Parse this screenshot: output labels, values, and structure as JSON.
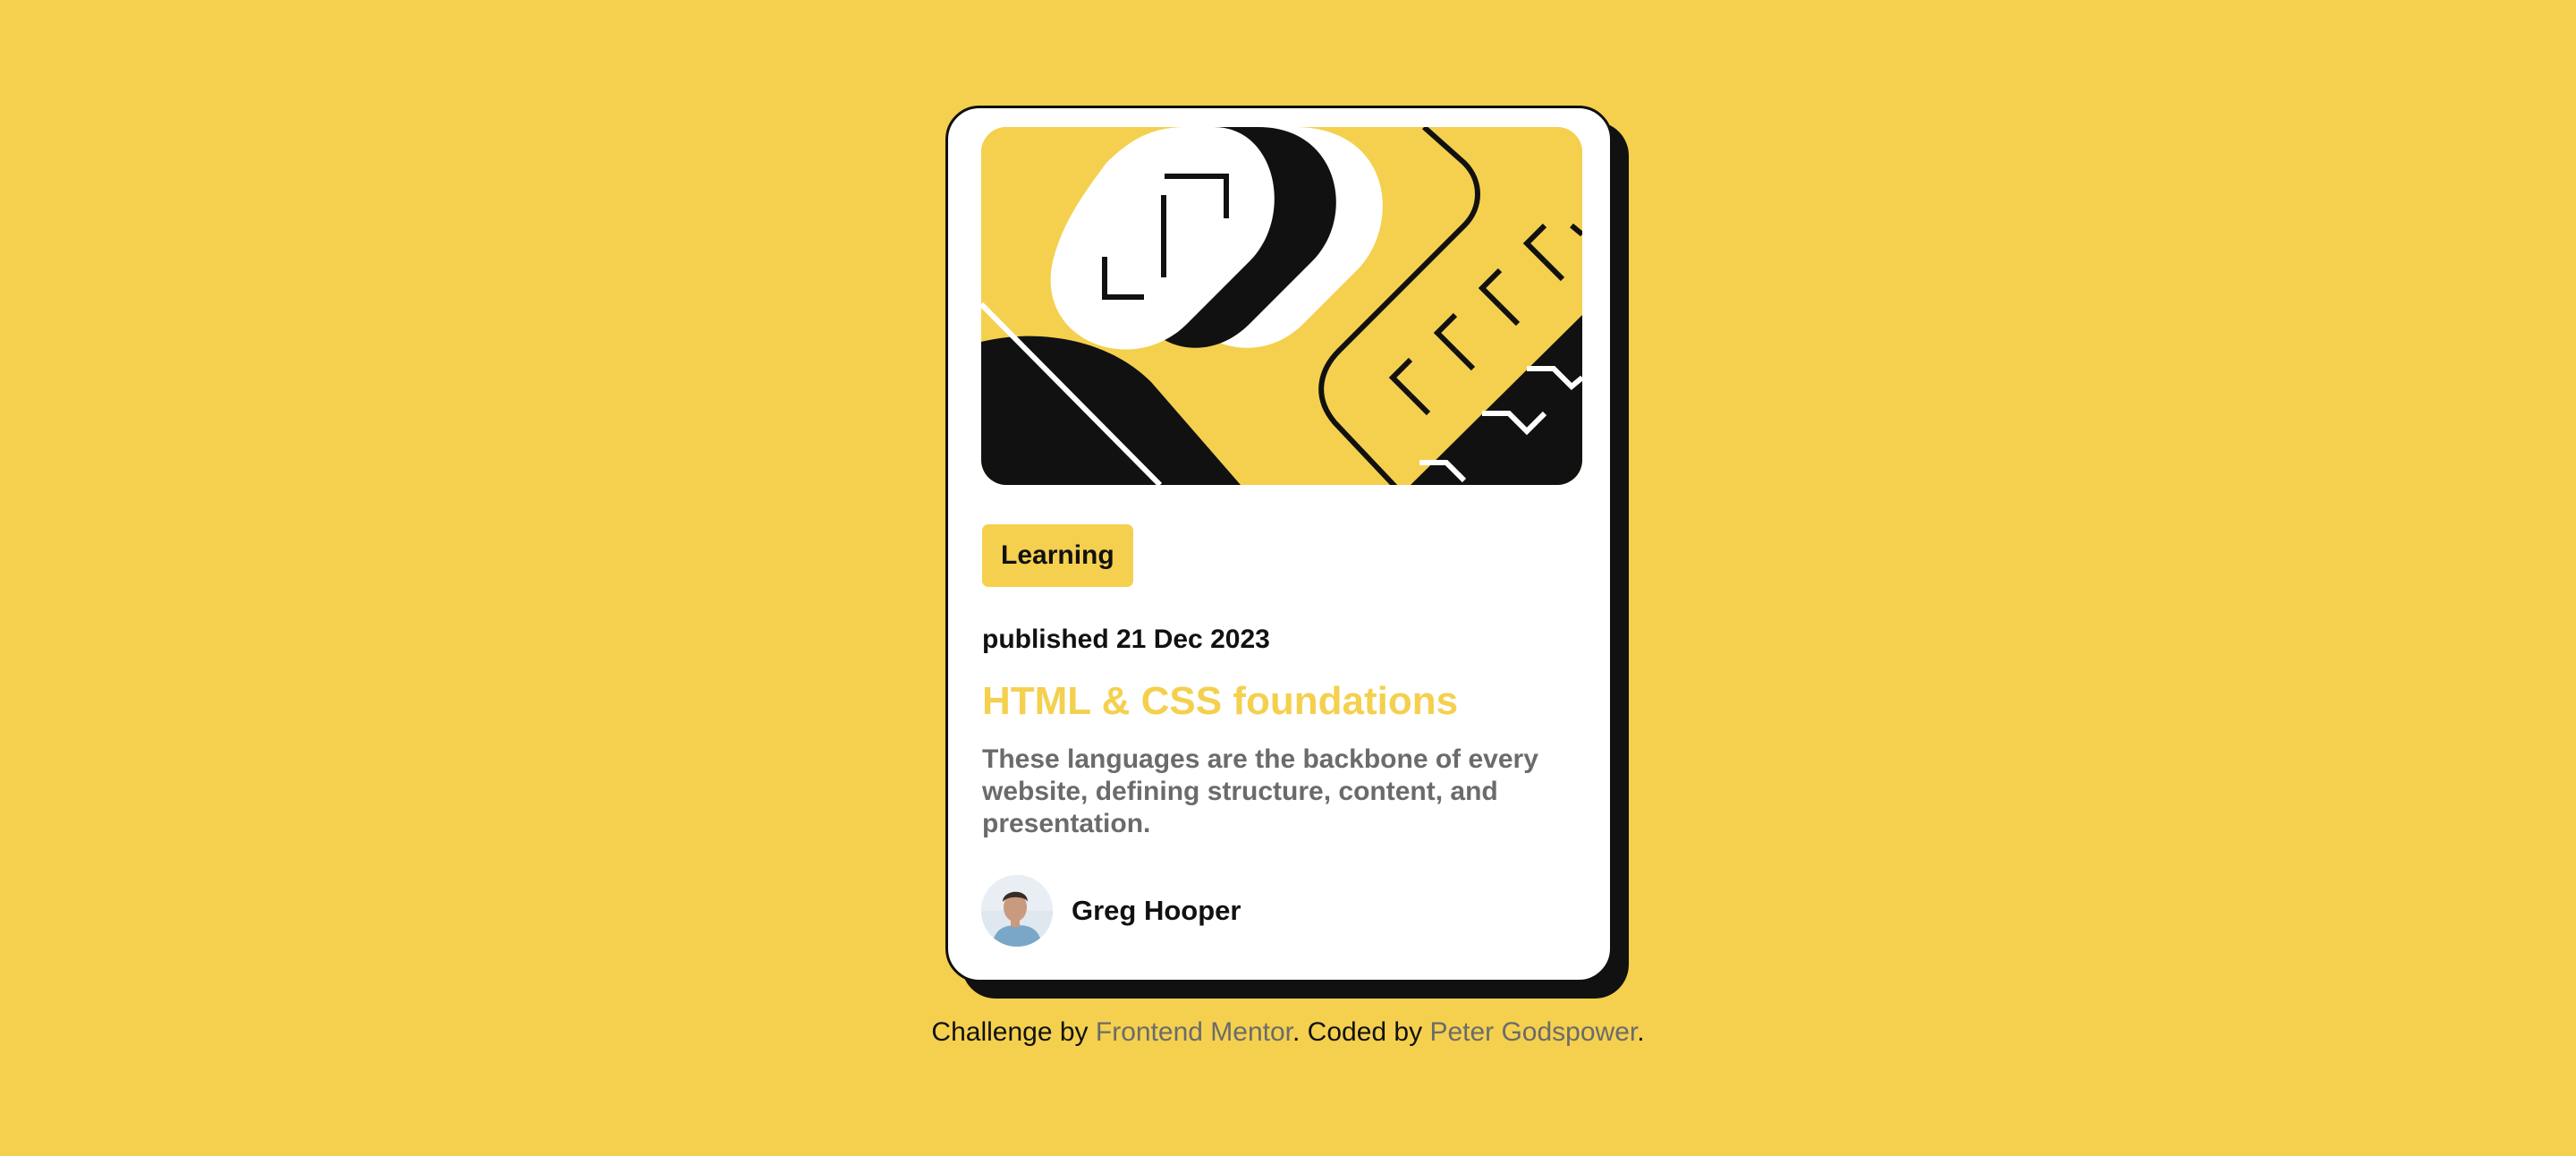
{
  "card": {
    "tag": "Learning",
    "published": "published 21 Dec 2023",
    "title": "HTML & CSS foundations",
    "description": "These languages are the backbone of every website, defining structure, content, and presentation.",
    "author": {
      "name": "Greg Hooper",
      "avatar_icon": "avatar-photo"
    },
    "illustration_icon": "code-illustration"
  },
  "attribution": {
    "prefix": "Challenge by ",
    "link1": "Frontend Mentor",
    "middle": ". Coded by ",
    "link2": "Peter Godspower",
    "suffix": "."
  },
  "colors": {
    "background": "#F4D04E",
    "card": "#FFFFFF",
    "ink": "#111111",
    "muted": "#6B6B6B",
    "accent": "#F4D04E"
  }
}
